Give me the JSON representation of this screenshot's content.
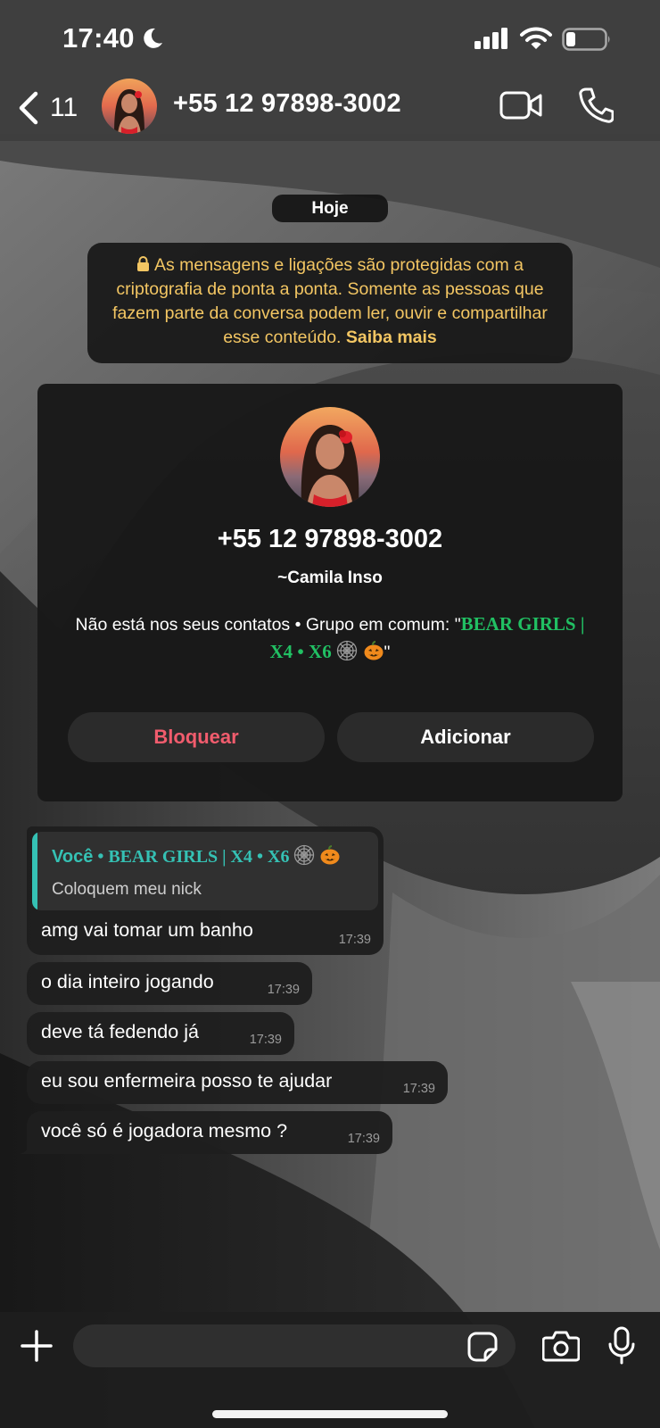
{
  "status_bar": {
    "time": "17:40",
    "icons": [
      "moon-icon",
      "cellular-signal-icon",
      "wifi-icon",
      "battery-icon"
    ]
  },
  "header": {
    "back_count": "11",
    "title": "+55 12 97898-3002",
    "icons": [
      "chevron-left-icon",
      "video-call-icon",
      "phone-call-icon"
    ]
  },
  "chat": {
    "date_chip": "Hoje",
    "encryption_notice": {
      "text": "As mensagens e ligações são protegidas com a criptografia de ponta a ponta. Somente as pessoas que fazem parte da conversa podem ler, ouvir e compartilhar esse conteúdo.",
      "link": "Saiba mais"
    },
    "contact_card": {
      "phone": "+55 12 97898-3002",
      "name": "~Camila Inso",
      "info_prefix": "Não está nos seus contatos • Grupo em comum: \"",
      "group_name": "BEAR GIRLS | X4 • X6",
      "info_suffix": "\"",
      "block_label": "Bloquear",
      "add_label": "Adicionar"
    },
    "quote": {
      "author": "Você",
      "separator": " • ",
      "group": "BEAR GIRLS | X4 • X6",
      "text": "Coloquem meu nick"
    },
    "messages": [
      {
        "text": "amg vai tomar um banho",
        "time": "17:39"
      },
      {
        "text": "o dia inteiro jogando",
        "time": "17:39"
      },
      {
        "text": "deve tá fedendo já",
        "time": "17:39"
      },
      {
        "text": "eu sou enfermeira posso te ajudar",
        "time": "17:39"
      },
      {
        "text": "você só é jogadora mesmo ?",
        "time": "17:39"
      }
    ]
  },
  "composer": {
    "input_value": "",
    "icons": [
      "plus-icon",
      "sticker-icon",
      "camera-icon",
      "microphone-icon"
    ]
  },
  "colors": {
    "encryption_text": "#f3c663",
    "block_red": "#f15c6d",
    "group_green": "#21c063",
    "quote_teal": "#35c1b4"
  }
}
